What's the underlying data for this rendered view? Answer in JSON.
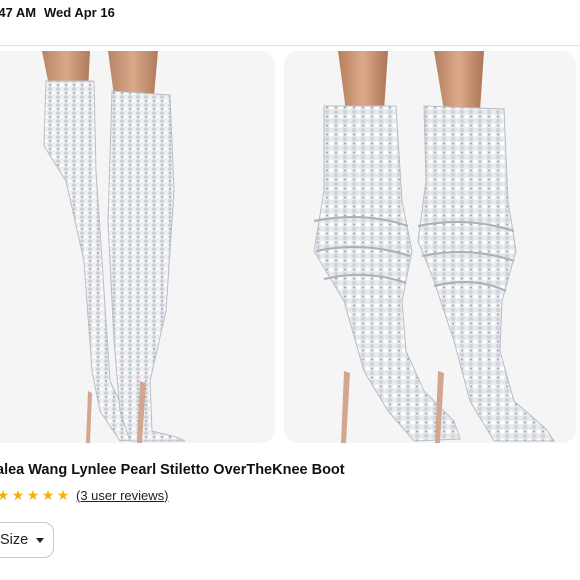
{
  "status_bar": {
    "time": ":47 AM",
    "date": "Wed Apr 16"
  },
  "gallery": {
    "photos": [
      {
        "icon": "boot-photo-straight"
      },
      {
        "icon": "boot-photo-slouched"
      }
    ],
    "colors": {
      "card_bg": "#f5f5f6",
      "heel": "#d3a78f",
      "crystal": "#dfe2e6"
    }
  },
  "product": {
    "title": "alea Wang Lynlee Pearl Stiletto OverTheKnee Boot",
    "rating": {
      "stars": 5,
      "max": 5,
      "star_color": "#f5b301"
    },
    "reviews_text": "(3 user reviews)"
  },
  "size_selector": {
    "label": "Size"
  }
}
